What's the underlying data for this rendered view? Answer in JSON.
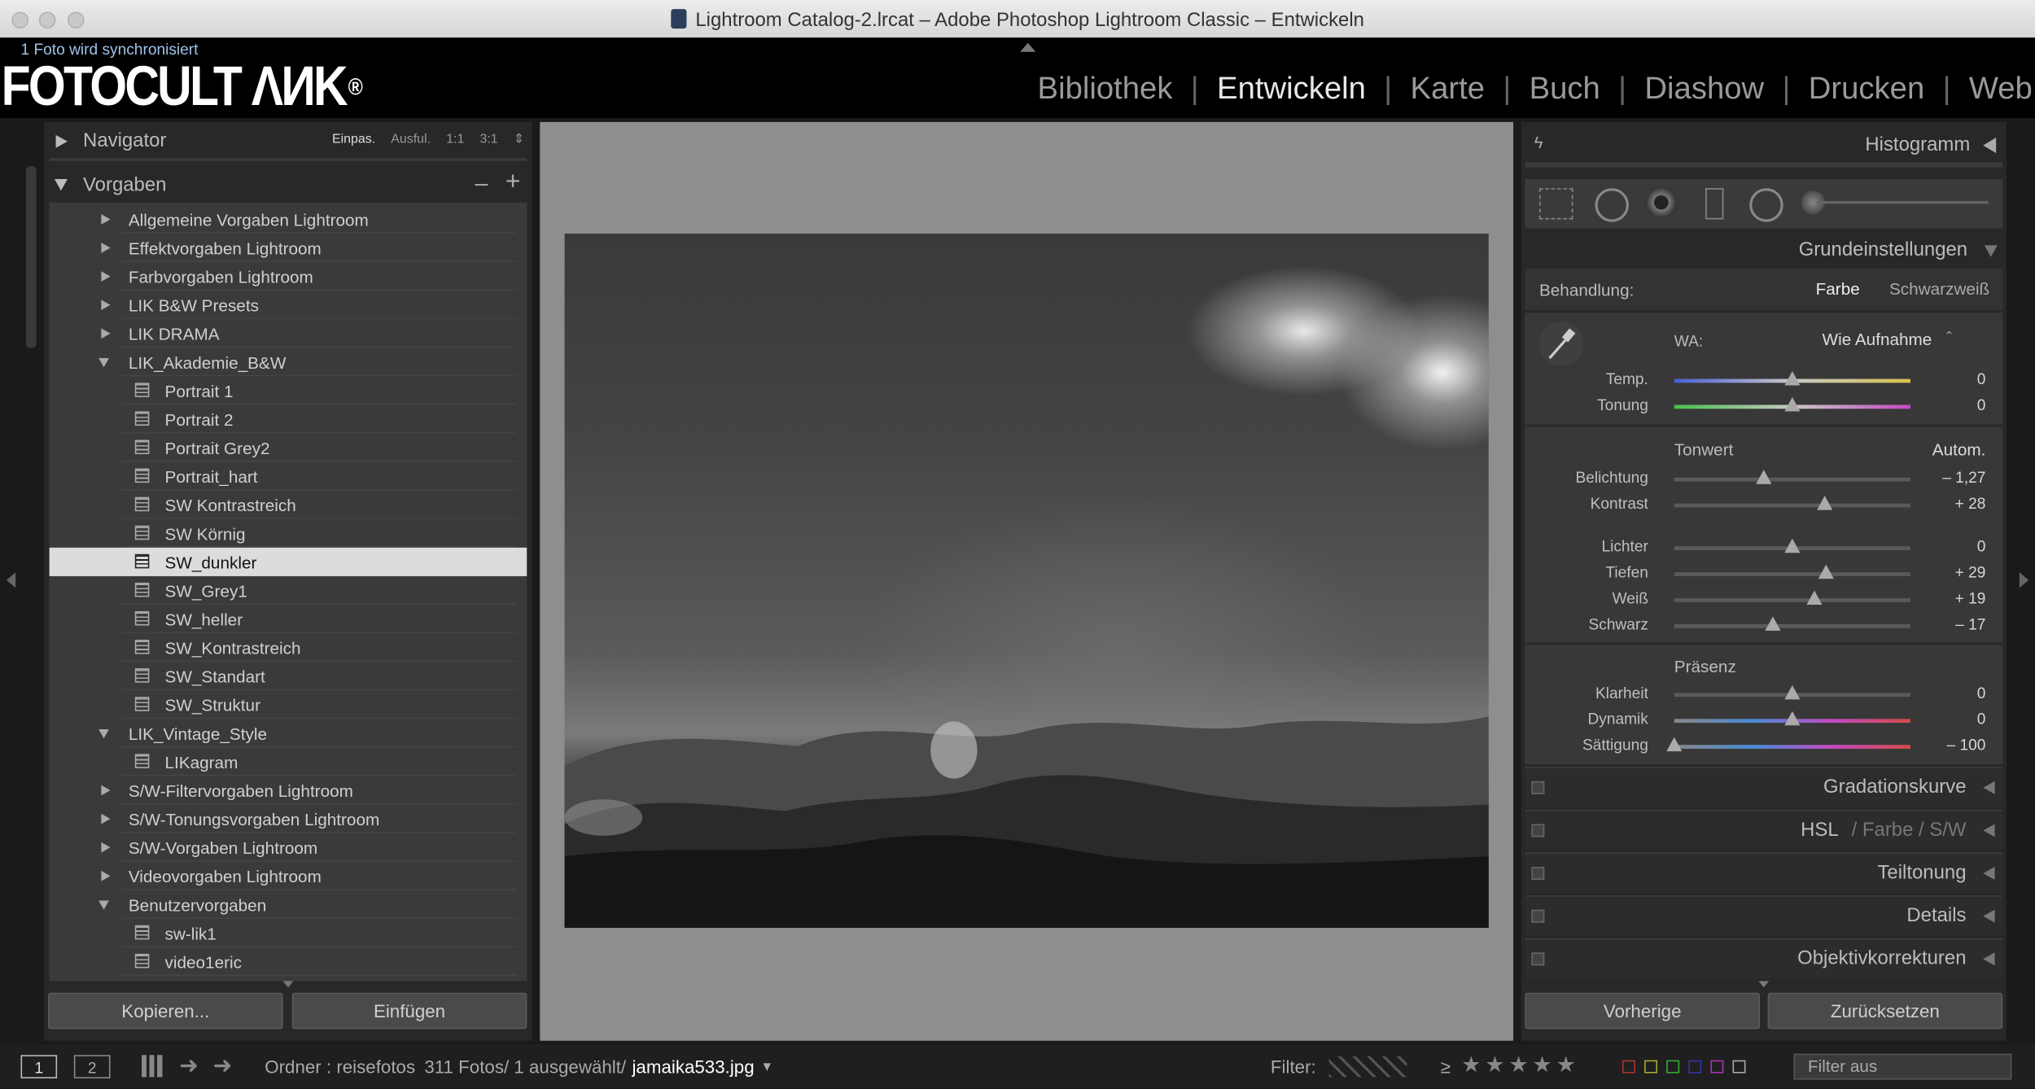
{
  "window": {
    "title": "Lightroom Catalog-2.lrcat – Adobe Photoshop Lightroom Classic – Entwickeln"
  },
  "identity": {
    "sync_status": "1 Foto wird synchronisiert",
    "logo_text": "FOTOCULT ΛИK",
    "logo_reg": "®",
    "modules": [
      "Bibliothek",
      "Entwickeln",
      "Karte",
      "Buch",
      "Diashow",
      "Drucken",
      "Web"
    ],
    "active_module": "Entwickeln"
  },
  "left": {
    "navigator": {
      "title": "Navigator",
      "zoom_options": [
        "Einpas.",
        "Ausful.",
        "1:1",
        "3:1"
      ],
      "active_zoom": "Einpas."
    },
    "presets": {
      "title": "Vorgaben",
      "minus": "–",
      "plus": "+",
      "items": [
        {
          "label": "Allgemeine Vorgaben Lightroom",
          "kind": "folder-closed"
        },
        {
          "label": "Effektvorgaben Lightroom",
          "kind": "folder-closed"
        },
        {
          "label": "Farbvorgaben Lightroom",
          "kind": "folder-closed"
        },
        {
          "label": "LIK B&W Presets",
          "kind": "folder-closed"
        },
        {
          "label": "LIK DRAMA",
          "kind": "folder-closed"
        },
        {
          "label": "LIK_Akademie_B&W",
          "kind": "folder-open"
        },
        {
          "label": "Portrait 1",
          "kind": "preset"
        },
        {
          "label": "Portrait 2",
          "kind": "preset"
        },
        {
          "label": "Portrait Grey2",
          "kind": "preset"
        },
        {
          "label": "Portrait_hart",
          "kind": "preset"
        },
        {
          "label": "SW Kontrastreich",
          "kind": "preset"
        },
        {
          "label": "SW Körnig",
          "kind": "preset"
        },
        {
          "label": "SW_dunkler",
          "kind": "preset",
          "selected": true
        },
        {
          "label": "SW_Grey1",
          "kind": "preset"
        },
        {
          "label": "SW_heller",
          "kind": "preset"
        },
        {
          "label": "SW_Kontrastreich",
          "kind": "preset"
        },
        {
          "label": "SW_Standart",
          "kind": "preset"
        },
        {
          "label": "SW_Struktur",
          "kind": "preset"
        },
        {
          "label": "LIK_Vintage_Style",
          "kind": "folder-open"
        },
        {
          "label": "LIKagram",
          "kind": "preset"
        },
        {
          "label": "S/W-Filtervorgaben Lightroom",
          "kind": "folder-closed"
        },
        {
          "label": "S/W-Tonungsvorgaben Lightroom",
          "kind": "folder-closed"
        },
        {
          "label": "S/W-Vorgaben Lightroom",
          "kind": "folder-closed"
        },
        {
          "label": "Videovorgaben Lightroom",
          "kind": "folder-closed"
        },
        {
          "label": "Benutzervorgaben",
          "kind": "folder-open"
        },
        {
          "label": "sw-lik1",
          "kind": "preset"
        },
        {
          "label": "video1eric",
          "kind": "preset"
        }
      ]
    },
    "copy_button": "Kopieren...",
    "paste_button": "Einfügen"
  },
  "right": {
    "histogram": {
      "title": "Histogramm"
    },
    "basic": {
      "title": "Grundeinstellungen",
      "treatment_label": "Behandlung:",
      "treatment_color": "Farbe",
      "treatment_bw": "Schwarzweiß",
      "wb_label": "WA:",
      "wb_value": "Wie Aufnahme",
      "tone_label": "Tonwert",
      "auto_button": "Autom.",
      "presence_label": "Präsenz",
      "sliders": [
        {
          "label": "Temp.",
          "value": "0",
          "pos": 0.5,
          "track": "temp"
        },
        {
          "label": "Tonung",
          "value": "0",
          "pos": 0.5,
          "track": "tint"
        },
        {
          "label": "Belichtung",
          "value": "– 1,27",
          "pos": 0.3775,
          "track": "gray"
        },
        {
          "label": "Kontrast",
          "value": "+ 28",
          "pos": 0.64,
          "track": "gray"
        },
        {
          "label": "Lichter",
          "value": "0",
          "pos": 0.5,
          "track": "gray"
        },
        {
          "label": "Tiefen",
          "value": "+ 29",
          "pos": 0.645,
          "track": "gray"
        },
        {
          "label": "Weiß",
          "value": "+ 19",
          "pos": 0.595,
          "track": "gray"
        },
        {
          "label": "Schwarz",
          "value": "– 17",
          "pos": 0.415,
          "track": "gray"
        },
        {
          "label": "Klarheit",
          "value": "0",
          "pos": 0.5,
          "track": "gray"
        },
        {
          "label": "Dynamik",
          "value": "0",
          "pos": 0.5,
          "track": "vib"
        },
        {
          "label": "Sättigung",
          "value": "– 100",
          "pos": 0.0,
          "track": "vib"
        }
      ]
    },
    "sections": [
      {
        "name": "Gradationskurve"
      },
      {
        "name": "HSL",
        "extra": "/  Farbe  /  S/W"
      },
      {
        "name": "Teiltonung"
      },
      {
        "name": "Details"
      },
      {
        "name": "Objektivkorrekturen"
      }
    ],
    "prev_button": "Vorherige",
    "reset_button": "Zurücksetzen"
  },
  "filmstrip": {
    "screen1": "1",
    "screen2": "2",
    "source": "Ordner : reisefotos",
    "count": "311 Fotos/ 1 ausgewählt/",
    "filename": "jamaika533.jpg",
    "filter_label": "Filter:",
    "rating_op": "≥",
    "stars": "★★★★★",
    "filter_preset": "Filter aus"
  },
  "colors": {
    "accent_sync": "#9ec3e8",
    "panel_bg": "#282828",
    "preset_bg": "#3a3a3a",
    "canvas": "#8e8e8e"
  }
}
